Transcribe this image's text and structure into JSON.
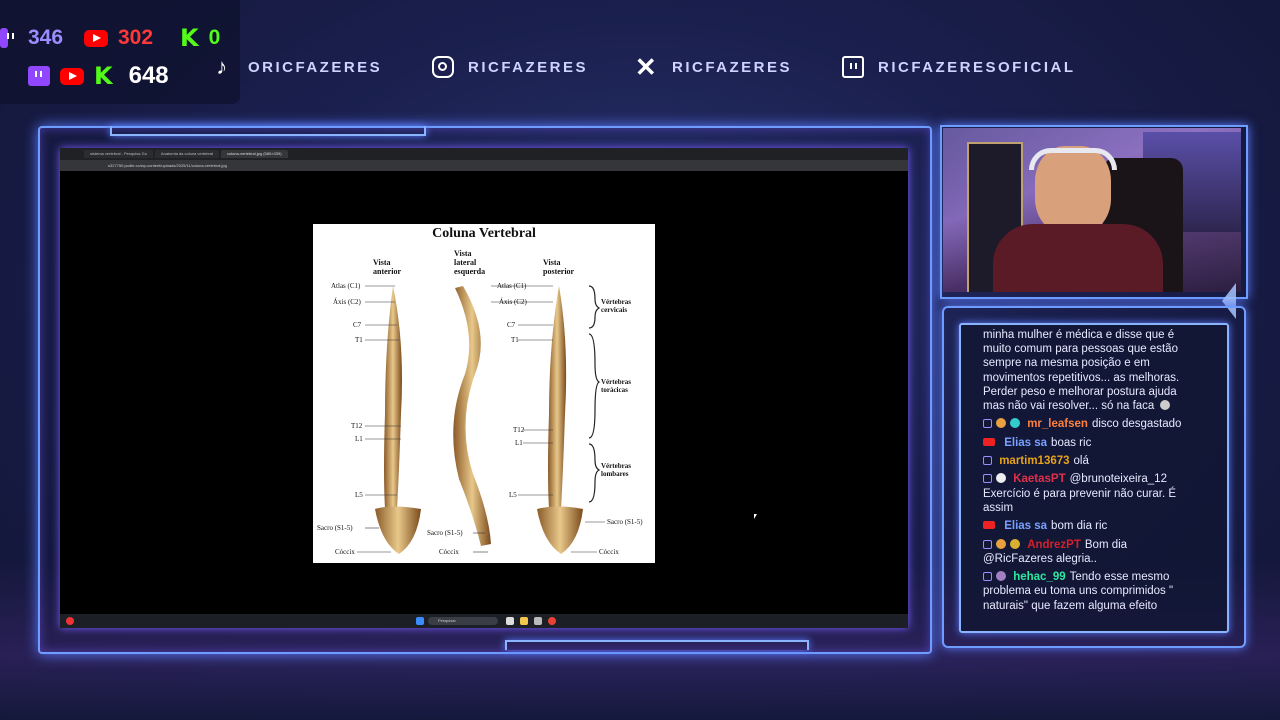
{
  "stats": {
    "twitch_viewers": "346",
    "youtube_viewers": "302",
    "kick_viewers": "0",
    "total_viewers": "648"
  },
  "socials": {
    "tiktok": "ORICFAZERES",
    "instagram": "RICFAZERES",
    "x": "RICFAZERES",
    "twitch": "RICFAZERESOFICIAL"
  },
  "browser": {
    "tabs": [
      "sistema vertebral - Pesquisa Go",
      "Anatomia da coluna vertebral",
      "coluna-vertebral.jpg (580×339)"
    ],
    "url": "s327750.podbr.cc/wp-content/uploads/2025/11/coluna-vertebral.jpg"
  },
  "taskbar": {
    "search_placeholder": "Pesquisar"
  },
  "diagram": {
    "title": "Coluna Vertebral",
    "view_anterior": "Vista anterior",
    "view_lateral": "Vista lateral esquerda",
    "view_posterior": "Vista posterior",
    "labels_left": [
      "Atlas (C1)",
      "Áxis (C2)",
      "C7",
      "T1",
      "T12",
      "L1",
      "L5",
      "Sacro (S1-5)",
      "Cóccix"
    ],
    "labels_mid": [
      "Atlas (C1)",
      "Áxis (C2)",
      "C7",
      "T1",
      "T12",
      "L1",
      "L5",
      "Sacro (S1-5)",
      "Cóccix"
    ],
    "labels_right": [
      "Sacro (S1-5)",
      "Cóccix"
    ],
    "group_cervical": "Vértebras cervicais",
    "group_toracic": "Vértebras torácicas",
    "group_lombar": "Vértebras lombares"
  },
  "chat": {
    "partial": "minha mulher é médica e disse que é muito comum para pessoas que estão sempre na mesma posição e em movimentos repetitivos... as melhoras. Perder peso e melhorar postura ajuda mas não vai resolver... só na faca",
    "messages": [
      {
        "user": "mr_leafsen",
        "text": "disco desgastado",
        "color": "#ff8040",
        "platform": "twitch"
      },
      {
        "user": "Elias sa",
        "text": "boas ric",
        "color": "#7aa0ff",
        "platform": "youtube"
      },
      {
        "user": "martim13673",
        "text": "olá",
        "color": "#e6a21a",
        "platform": "twitch"
      },
      {
        "user": "KaetasPT",
        "text": "@brunoteixeira_12 Exercício é para prevenir não curar. É assim",
        "color": "#e0304a",
        "platform": "twitch"
      },
      {
        "user": "Elias sa",
        "text": "bom dia ric",
        "color": "#7aa0ff",
        "platform": "youtube"
      },
      {
        "user": "AndrezPT",
        "text": "Bom dia @RicFazeres alegria..",
        "color": "#d4202a",
        "platform": "twitch"
      },
      {
        "user": "hehac_99",
        "text": "Tendo esse mesmo problema eu toma uns comprimidos \" naturais\" que fazem alguma efeito",
        "color": "#2ee8a0",
        "platform": "twitch"
      }
    ]
  }
}
